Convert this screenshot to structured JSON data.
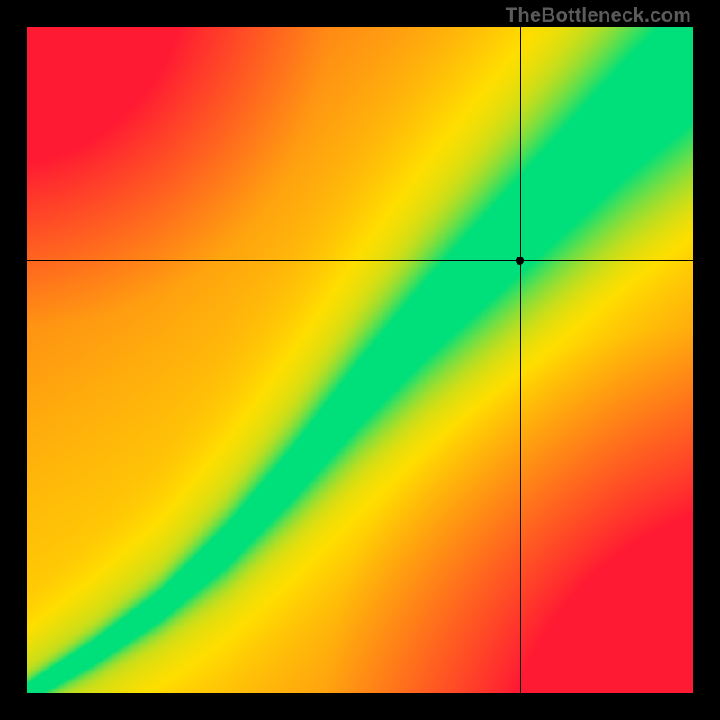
{
  "watermark": "TheBottleneck.com",
  "chart_data": {
    "type": "heatmap",
    "title": "",
    "xlabel": "",
    "ylabel": "",
    "xlim": [
      0,
      100
    ],
    "ylim": [
      0,
      100
    ],
    "grid": false,
    "legend": false,
    "crosshair": {
      "x": 74.0,
      "y": 65.0
    },
    "marker": {
      "x": 74.0,
      "y": 65.0
    },
    "colors": {
      "low": "#ff1a33",
      "mid": "#ffde00",
      "high": "#00e07a"
    },
    "optimal_ridge": [
      {
        "x": 0,
        "y": 0
      },
      {
        "x": 10,
        "y": 6
      },
      {
        "x": 20,
        "y": 13
      },
      {
        "x": 30,
        "y": 22
      },
      {
        "x": 40,
        "y": 33
      },
      {
        "x": 50,
        "y": 45
      },
      {
        "x": 60,
        "y": 56
      },
      {
        "x": 70,
        "y": 66
      },
      {
        "x": 80,
        "y": 76
      },
      {
        "x": 90,
        "y": 86
      },
      {
        "x": 100,
        "y": 95
      }
    ],
    "ridge_half_width": [
      {
        "x": 0,
        "w": 1.2
      },
      {
        "x": 20,
        "w": 2.5
      },
      {
        "x": 40,
        "w": 5
      },
      {
        "x": 60,
        "w": 8
      },
      {
        "x": 80,
        "w": 11
      },
      {
        "x": 100,
        "w": 14
      }
    ]
  }
}
